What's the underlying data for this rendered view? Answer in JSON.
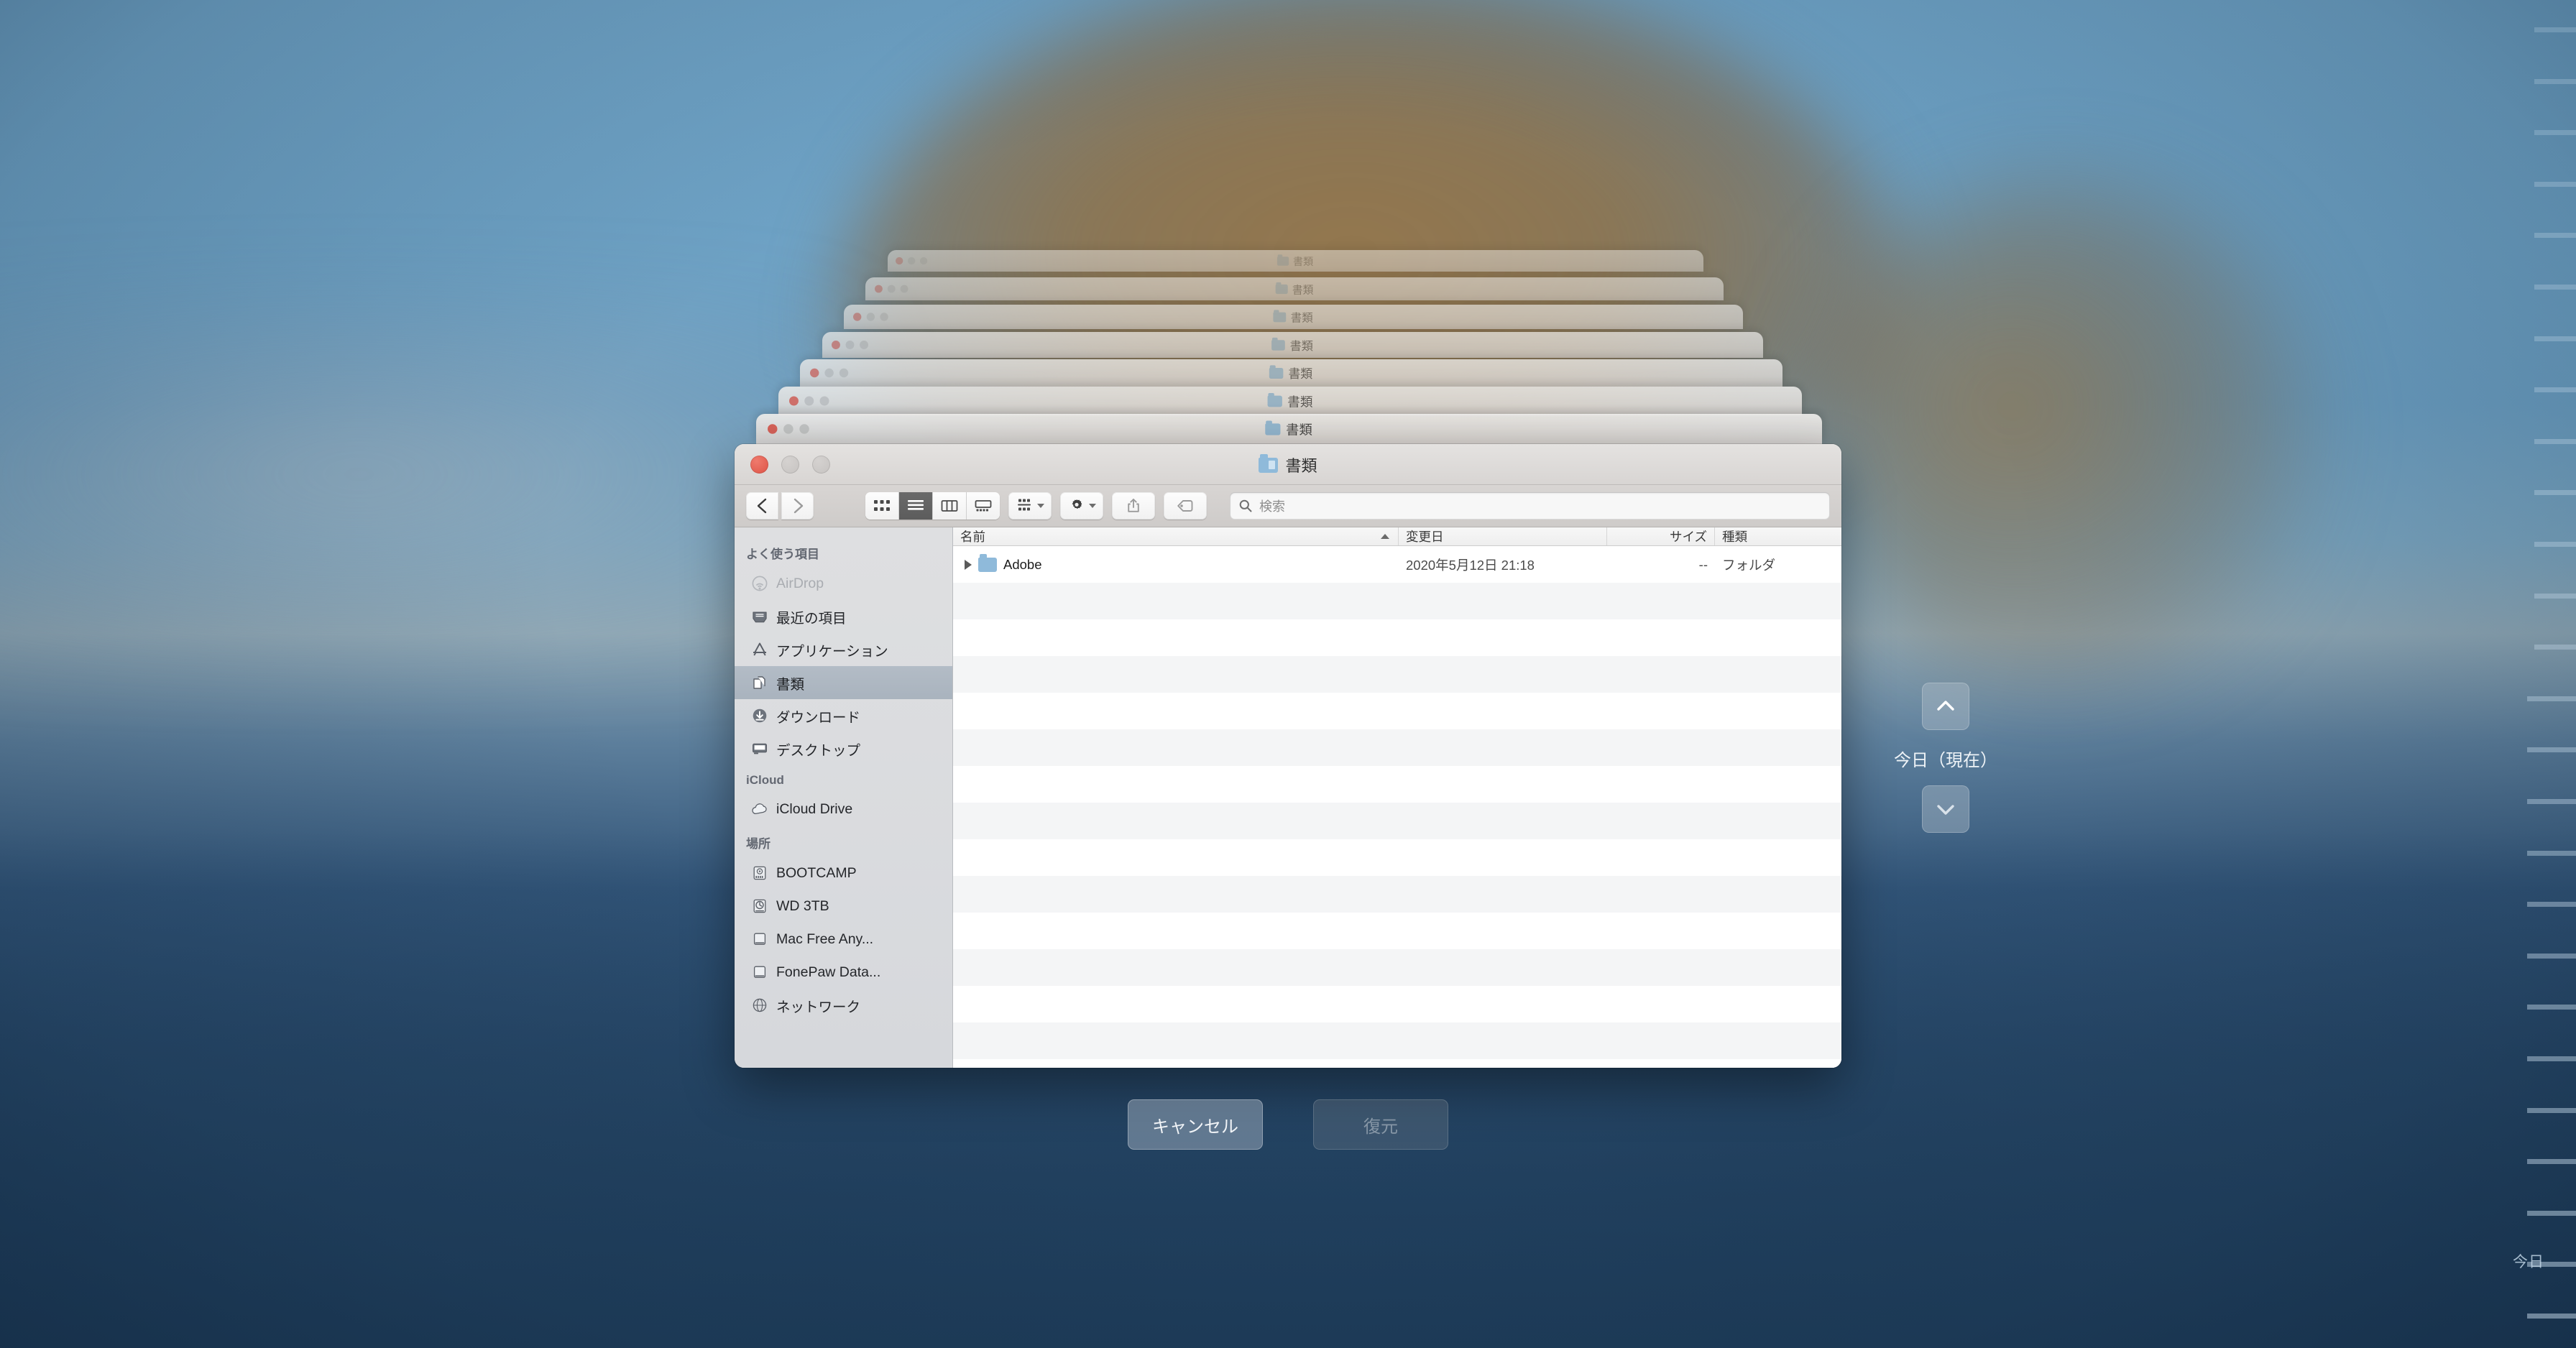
{
  "window": {
    "title": "書類",
    "traffic_lights": [
      "close",
      "minimize",
      "zoom"
    ],
    "colors": {
      "close": "#dd5346",
      "minimize": "#c6c3c1",
      "zoom": "#c6c3c1",
      "folder_blue": "#8fbada",
      "selection": "#a9b3be",
      "desktop_sky": "#6fa3c6",
      "desktop_water": "#2b4a69",
      "landmass": "#8e7046"
    }
  },
  "toolbar": {
    "back_label": "戻る",
    "forward_label": "進む",
    "view_modes": [
      {
        "name": "icon-view",
        "label": "アイコン表示",
        "active": false
      },
      {
        "name": "list-view",
        "label": "リスト表示",
        "active": true
      },
      {
        "name": "column-view",
        "label": "カラム表示",
        "active": false
      },
      {
        "name": "gallery-view",
        "label": "ギャラリー表示",
        "active": false
      }
    ],
    "arrange_label": "グループ分け",
    "action_label": "操作",
    "share_label": "共有",
    "tags_label": "タグ"
  },
  "search": {
    "placeholder": "検索",
    "value": ""
  },
  "sidebar": {
    "sections": [
      {
        "header": "よく使う項目",
        "items": [
          {
            "label": "AirDrop",
            "icon": "airdrop-icon",
            "state": "dim"
          },
          {
            "label": "最近の項目",
            "icon": "recents-icon",
            "state": "normal"
          },
          {
            "label": "アプリケーション",
            "icon": "applications-icon",
            "state": "normal"
          },
          {
            "label": "書類",
            "icon": "documents-icon",
            "state": "selected"
          },
          {
            "label": "ダウンロード",
            "icon": "downloads-icon",
            "state": "normal"
          },
          {
            "label": "デスクトップ",
            "icon": "desktop-icon",
            "state": "normal"
          }
        ]
      },
      {
        "header": "iCloud",
        "items": [
          {
            "label": "iCloud Drive",
            "icon": "icloud-icon",
            "state": "normal"
          }
        ]
      },
      {
        "header": "場所",
        "items": [
          {
            "label": "BOOTCAMP",
            "icon": "internal-drive-icon",
            "state": "normal"
          },
          {
            "label": "WD 3TB",
            "icon": "timemachine-drive-icon",
            "state": "normal"
          },
          {
            "label": "Mac Free Any...",
            "icon": "external-drive-icon",
            "state": "normal"
          },
          {
            "label": "FonePaw Data...",
            "icon": "external-drive-icon",
            "state": "normal"
          },
          {
            "label": "ネットワーク",
            "icon": "network-icon",
            "state": "cut-off"
          }
        ]
      }
    ]
  },
  "filelist": {
    "columns": [
      {
        "key": "name",
        "label": "名前",
        "sorted": true,
        "sort_direction": "asc"
      },
      {
        "key": "date",
        "label": "変更日",
        "sorted": false
      },
      {
        "key": "size",
        "label": "サイズ",
        "sorted": false
      },
      {
        "key": "kind",
        "label": "種類",
        "sorted": false
      }
    ],
    "rows": [
      {
        "name": "Adobe",
        "date": "2020年5月12日 21:18",
        "size": "--",
        "kind": "フォルダ",
        "has_disclosure": true,
        "icon": "folder-icon"
      }
    ],
    "empty_row_count": 14
  },
  "actions": {
    "cancel_label": "キャンセル",
    "restore_label": "復元",
    "restore_enabled": false
  },
  "timemachine": {
    "current_date_label": "今日（現在）",
    "timeline_today_label": "今日",
    "up_arrow_label": "過去のバックアップへ",
    "down_arrow_label": "新しいバックアップへ",
    "stacked_windows": [
      {
        "title": "書類"
      },
      {
        "title": "書類"
      },
      {
        "title": "書類"
      },
      {
        "title": "書類"
      },
      {
        "title": "書類"
      },
      {
        "title": "書類"
      },
      {
        "title": "書類"
      }
    ]
  }
}
